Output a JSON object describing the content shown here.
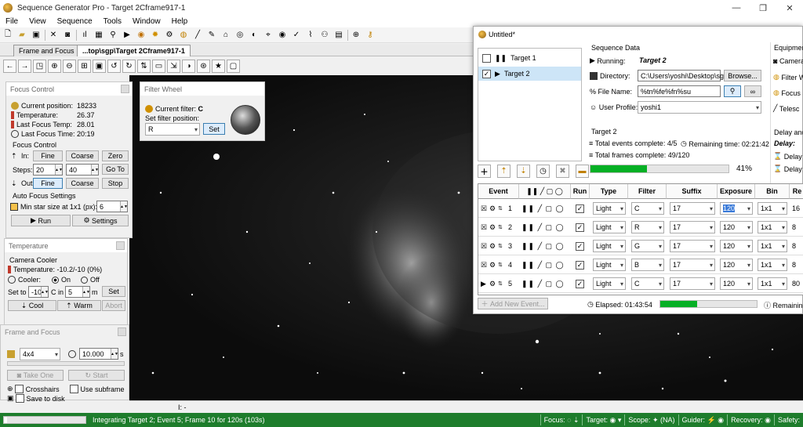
{
  "app": {
    "title": "Sequence Generator Pro - Target 2Cframe917-1"
  },
  "menu": [
    "File",
    "View",
    "Sequence",
    "Tools",
    "Window",
    "Help"
  ],
  "tabs": [
    "Frame and Focus",
    "...top\\sgp\\Target 2Cframe917-1"
  ],
  "focus_control": {
    "title": "Focus Control",
    "current_position_label": "Current position:",
    "current_position": "18233",
    "temperature_label": "Temperature:",
    "temperature": "26.37",
    "last_focus_temp_label": "Last Focus Temp:",
    "last_focus_temp": "28.01",
    "last_focus_time_label": "Last Focus Time:",
    "last_focus_time": "20:19",
    "section_label": "Focus Control",
    "in_label": "In:",
    "out_label": "Out:",
    "steps_label": "Steps:",
    "fine": "Fine",
    "coarse": "Coarse",
    "zero": "Zero",
    "goto": "Go To",
    "stop": "Stop",
    "steps_fine": "20",
    "steps_coarse": "40",
    "auto_focus_label": "Auto Focus Settings",
    "min_star_label": "Min star size at 1x1 (px):",
    "min_star_value": "6",
    "run": "Run",
    "settings": "Settings"
  },
  "filter_wheel": {
    "title": "Filter Wheel",
    "current_filter_label": "Current filter:",
    "current_filter": "C",
    "set_position_label": "Set filter position:",
    "position_value": "R",
    "set": "Set"
  },
  "temperature": {
    "title": "Temperature",
    "camera_cooler": "Camera Cooler",
    "temp_label": "Temperature:",
    "temp_value": "-10.2/-10 (0%)",
    "cooler_label": "Cooler:",
    "on": "On",
    "off": "Off",
    "set_to": "Set to",
    "set_value": "-10",
    "c_in": "C in",
    "minutes": "5",
    "m": "m",
    "set": "Set",
    "cool": "Cool",
    "warm": "Warm",
    "abort": "Abort"
  },
  "frame_focus": {
    "title": "Frame and Focus",
    "binning": "4x4",
    "exposure": "10.000",
    "s": "s",
    "take_one": "Take One",
    "start": "Start",
    "crosshairs": "Crosshairs",
    "use_subframe": "Use subframe",
    "save_to_disk": "Save to disk"
  },
  "sequence": {
    "window_title": "Untitled*",
    "targets": [
      {
        "name": "Target 1",
        "checked": false
      },
      {
        "name": "Target 2",
        "checked": true
      }
    ],
    "data_label": "Sequence Data",
    "running_label": "Running:",
    "running": "Target 2",
    "directory_label": "Directory:",
    "directory": "C:\\Users\\yoshi\\Desktop\\sg",
    "browse": "Browse...",
    "file_name_label": "File Name:",
    "file_name": "%tn%fe%fn%su",
    "user_profile_label": "User Profile:",
    "user_profile": "yoshi1",
    "target_label": "Target 2",
    "events_complete": "Total events complete: 4/5",
    "remaining_time": "Remaining time: 02:21:42",
    "frames_complete": "Total frames complete: 49/120",
    "progress_text": "41%",
    "progress_value": 41,
    "equipment_label": "Equipment",
    "equipment": [
      "Camera",
      "Filter W",
      "Focus",
      "Telesc"
    ],
    "delay_label": "Delay and",
    "delay_sub": "Delay:",
    "delay_items": [
      "Delay f",
      "Delay f"
    ],
    "columns": [
      "Event",
      "Run",
      "Type",
      "Filter",
      "Suffix",
      "Exposure",
      "Bin",
      "Re"
    ],
    "events": [
      {
        "num": "1",
        "type": "Light",
        "filter": "C",
        "suffix": "17",
        "exposure": "120",
        "bin": "1x1",
        "repeat": "16"
      },
      {
        "num": "2",
        "type": "Light",
        "filter": "R",
        "suffix": "17",
        "exposure": "120",
        "bin": "1x1",
        "repeat": "8"
      },
      {
        "num": "3",
        "type": "Light",
        "filter": "G",
        "suffix": "17",
        "exposure": "120",
        "bin": "1x1",
        "repeat": "8"
      },
      {
        "num": "4",
        "type": "Light",
        "filter": "B",
        "suffix": "17",
        "exposure": "120",
        "bin": "1x1",
        "repeat": "8"
      },
      {
        "num": "5",
        "type": "Light",
        "filter": "C",
        "suffix": "17",
        "exposure": "120",
        "bin": "1x1",
        "repeat": "80"
      }
    ],
    "add_event": "Add New Event...",
    "elapsed_label": "Elapsed:",
    "elapsed": "01:43:54",
    "elapsed_progress": 38,
    "remaining_short": "Remainin"
  },
  "statusbar": {
    "integrating": "Integrating Target 2; Event 5; Frame 10 for 120s (103s)",
    "integrating_progress": 4,
    "coord": "I: -",
    "focus": "Focus:",
    "target": "Target:",
    "scope": "Scope:",
    "scope_na": "(NA)",
    "guider": "Guider:",
    "recovery": "Recovery:",
    "safety": "Safety:"
  }
}
